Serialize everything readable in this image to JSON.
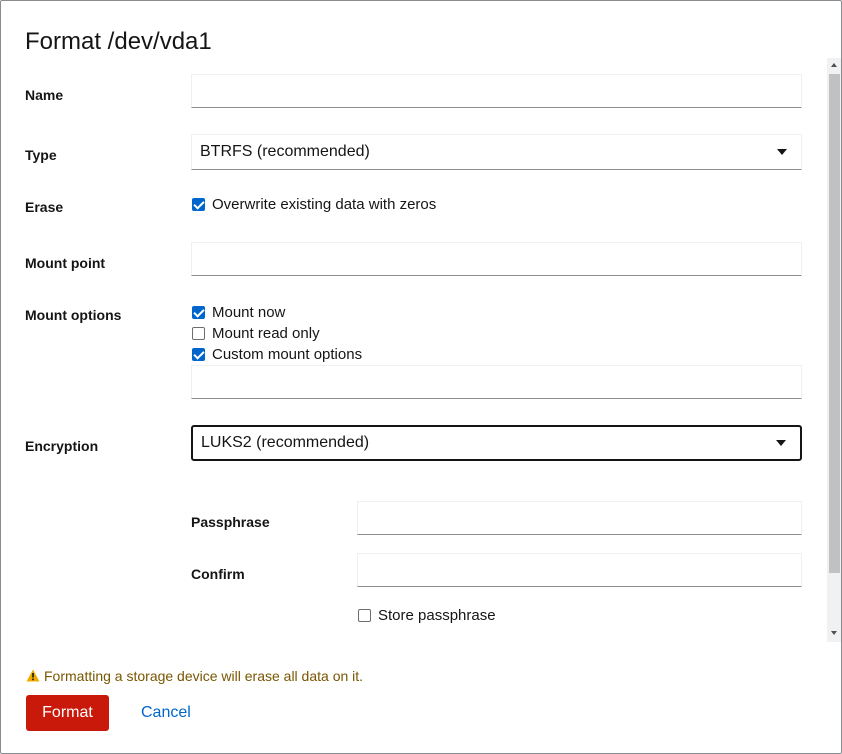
{
  "dialog": {
    "title": "Format /dev/vda1",
    "fields": {
      "name": {
        "label": "Name",
        "value": ""
      },
      "type": {
        "label": "Type",
        "selected": "BTRFS (recommended)"
      },
      "erase": {
        "label": "Erase",
        "option": "Overwrite existing data with zeros",
        "checked": true
      },
      "mount_point": {
        "label": "Mount point",
        "value": ""
      },
      "mount_options": {
        "label": "Mount options",
        "mount_now": {
          "label": "Mount now",
          "checked": true
        },
        "read_only": {
          "label": "Mount read only",
          "checked": false
        },
        "custom": {
          "label": "Custom mount options",
          "checked": true
        },
        "custom_value": ""
      },
      "encryption": {
        "label": "Encryption",
        "selected": "LUKS2 (recommended)"
      },
      "passphrase": {
        "label": "Passphrase",
        "value": ""
      },
      "confirm": {
        "label": "Confirm",
        "value": ""
      },
      "store_passphrase": {
        "label": "Store passphrase",
        "checked": false
      }
    },
    "warning": "Formatting a storage device will erase all data on it.",
    "buttons": {
      "format": "Format",
      "cancel": "Cancel"
    }
  },
  "colors": {
    "primary": "#c9190b",
    "link": "#0066cc",
    "checkbox": "#0066cc",
    "warning": "#795600",
    "warning_icon": "#f0ab00"
  },
  "icons": {
    "warning": "warning-triangle-icon",
    "caret": "caret-down-icon"
  }
}
